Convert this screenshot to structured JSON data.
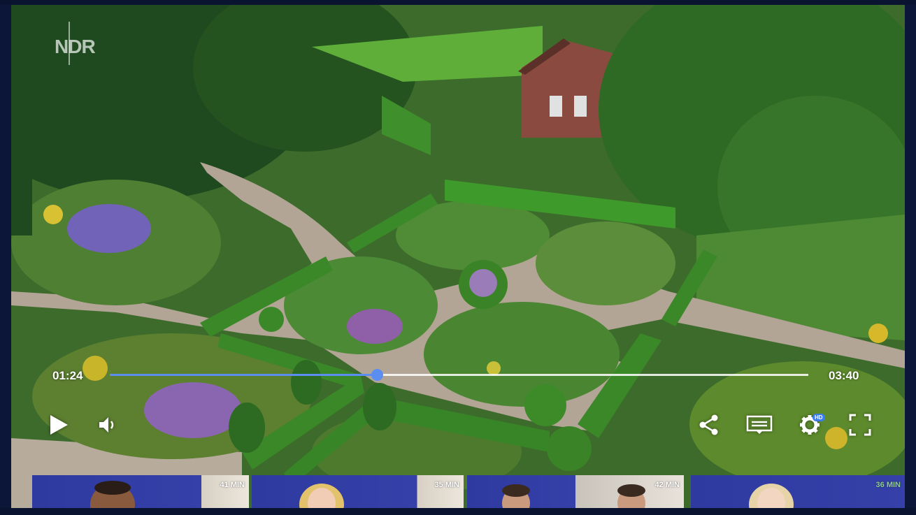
{
  "channel": {
    "logo_text": "NDR"
  },
  "player": {
    "current_time": "01:24",
    "total_time": "03:40",
    "progress": 0.382,
    "settings_badge": "HD"
  },
  "controls": {
    "play_icon": "play-icon",
    "volume_icon": "volume-icon",
    "share_icon": "share-icon",
    "subtitles_icon": "subtitles-icon",
    "settings_icon": "gear-icon",
    "fullscreen_icon": "fullscreen-icon"
  },
  "thumbnails": [
    {
      "duration": "41 MIN"
    },
    {
      "duration": "35 MIN"
    },
    {
      "duration": "42 MIN"
    },
    {
      "duration": "36 MIN"
    }
  ],
  "colors": {
    "accent": "#5b8ef0",
    "background": "#0a1330",
    "thumb_blue": "#2e3aa0"
  }
}
